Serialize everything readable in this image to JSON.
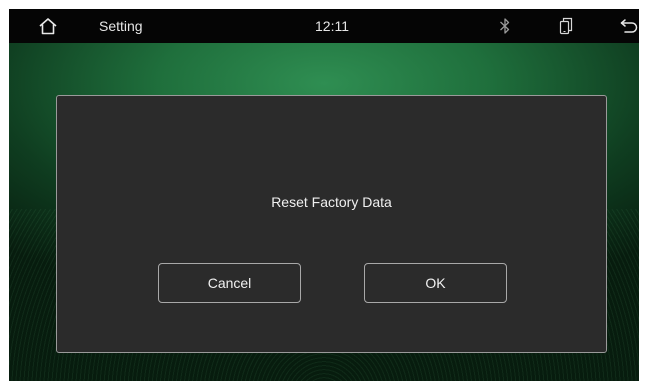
{
  "statusbar": {
    "title": "Setting",
    "time": "12:11",
    "icons": {
      "home": "home-icon",
      "bluetooth": "bluetooth-icon",
      "phone": "phone-link-icon",
      "back": "back-icon"
    }
  },
  "dialog": {
    "message": "Reset Factory Data",
    "cancel_label": "Cancel",
    "ok_label": "OK"
  },
  "colors": {
    "statusbar_bg": "#050505",
    "dialog_bg": "#2b2b2b",
    "dialog_border": "#9a9a9a",
    "background_green": "#1f6f3c"
  }
}
